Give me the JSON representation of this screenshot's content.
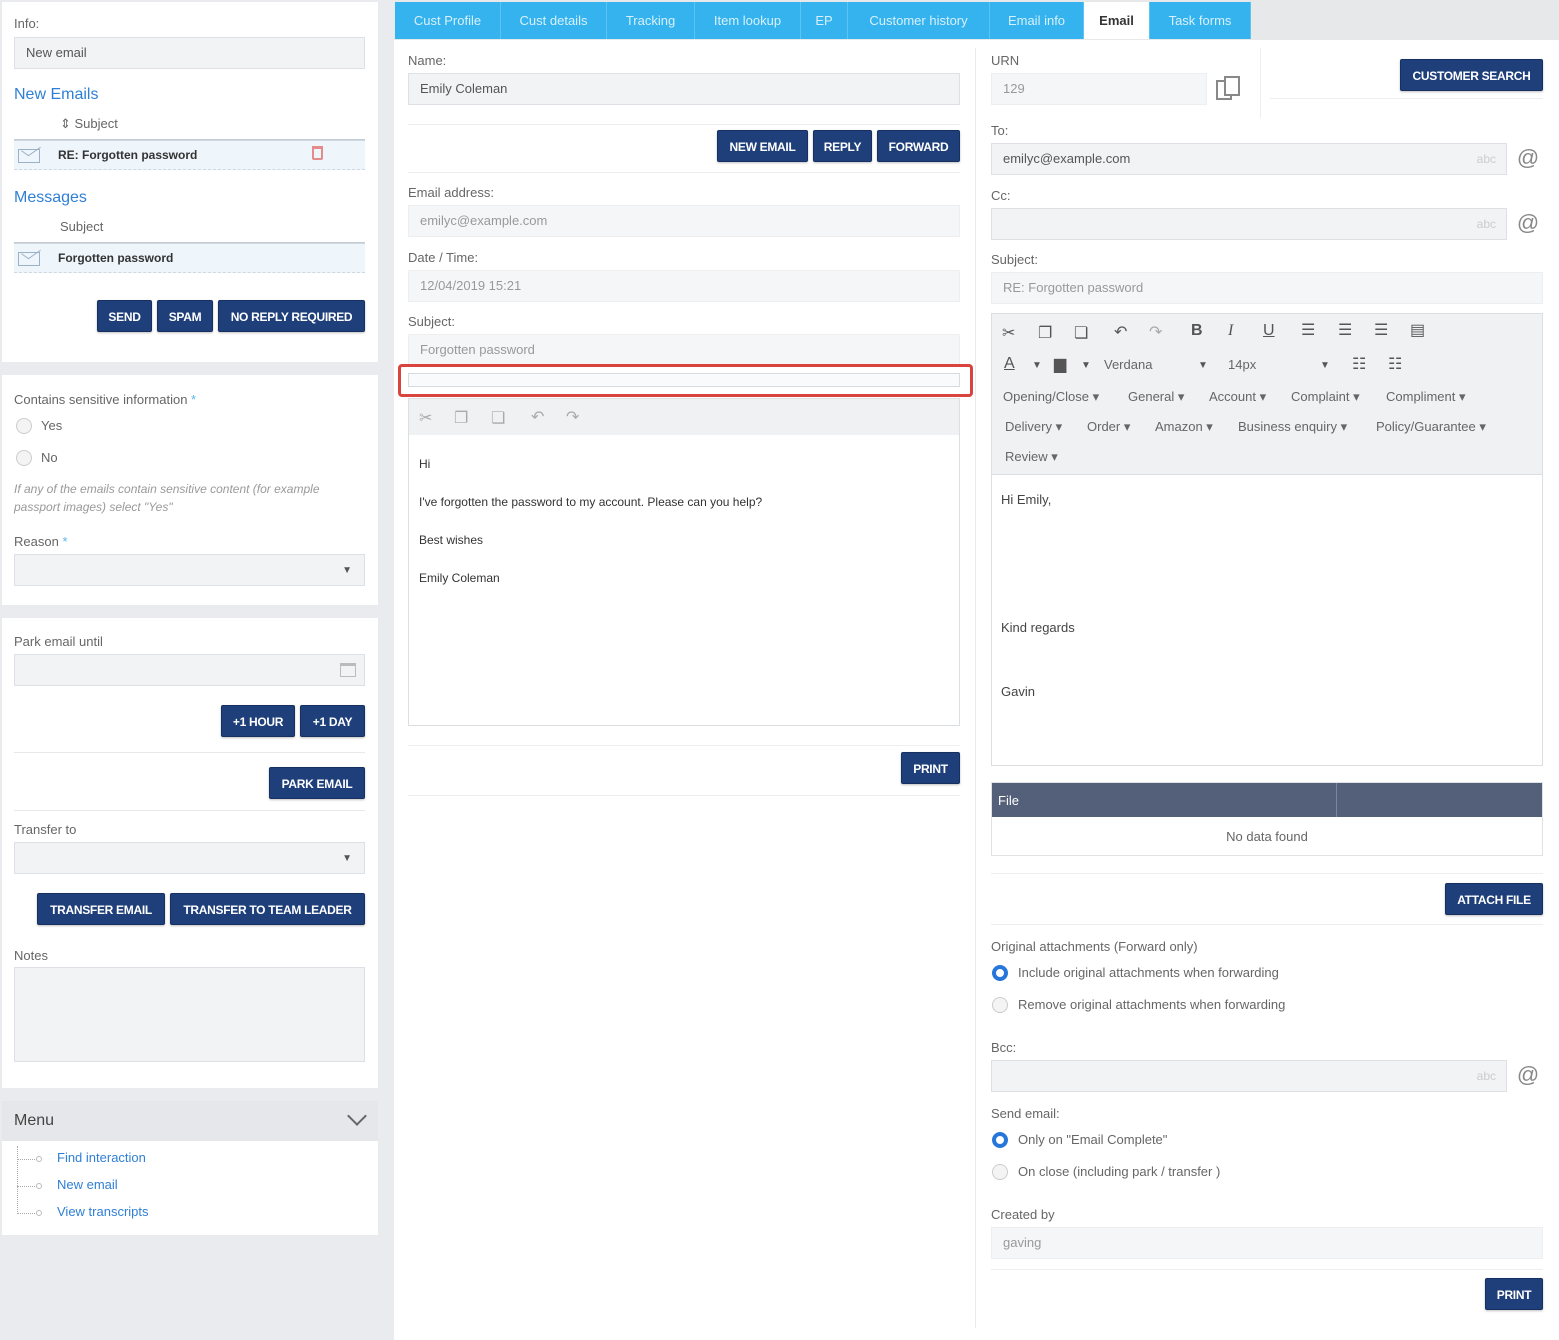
{
  "left": {
    "info_label": "Info:",
    "info_value": "New email",
    "new_emails_title": "New Emails",
    "new_emails_subject_header": "⇕ Subject",
    "new_emails": [
      {
        "subject": "RE: Forgotten password"
      }
    ],
    "messages_title": "Messages",
    "messages_subject_header": "Subject",
    "messages": [
      {
        "subject": "Forgotten password"
      }
    ],
    "send_label": "SEND",
    "spam_label": "SPAM",
    "no_reply_label": "NO REPLY REQUIRED",
    "sensitive_label": "Contains sensitive information",
    "required_mark": "*",
    "yes_label": "Yes",
    "no_label": "No",
    "sensitive_help": "If any of the emails contain sensitive content (for example passport images) select \"Yes\"",
    "reason_label": "Reason",
    "park_label": "Park email until",
    "plus_hour_label": "+1 HOUR",
    "plus_day_label": "+1 DAY",
    "park_email_label": "PARK EMAIL",
    "transfer_label": "Transfer to",
    "transfer_email_label": "TRANSFER EMAIL",
    "transfer_team_label": "TRANSFER TO TEAM LEADER",
    "notes_label": "Notes",
    "menu_title": "Menu",
    "menu_items": [
      "Find interaction",
      "New email",
      "View transcripts"
    ]
  },
  "tabs": [
    "Cust Profile",
    "Cust details",
    "Tracking",
    "Item lookup",
    "EP",
    "Customer history",
    "Email info",
    "Email",
    "Task forms"
  ],
  "active_tab": "Email",
  "middle": {
    "name_label": "Name:",
    "name_value": "Emily Coleman",
    "new_email_label": "NEW EMAIL",
    "reply_label": "REPLY",
    "forward_label": "FORWARD",
    "email_label": "Email address:",
    "email_value": "emilyc@example.com",
    "datetime_label": "Date / Time:",
    "datetime_value": "12/04/2019 15:21",
    "subject_label": "Subject:",
    "subject_value": "Forgotten password",
    "body_lines": [
      "Hi",
      "I've forgotten the password to my account. Please can you help?",
      "Best wishes",
      "Emily Coleman"
    ],
    "print_label": "PRINT"
  },
  "right": {
    "urn_label": "URN",
    "urn_value": "129",
    "customer_search_label": "CUSTOMER SEARCH",
    "to_label": "To:",
    "to_value": "emilyc@example.com",
    "abc": "abc",
    "cc_label": "Cc:",
    "subject_label": "Subject:",
    "subject_value": "RE: Forgotten password",
    "font_name": "Verdana",
    "font_size": "14px",
    "templates_row1": [
      "Opening/Close ▾",
      "General ▾",
      "Account ▾",
      "Complaint ▾",
      "Compliment ▾"
    ],
    "templates_row2": [
      "Delivery ▾",
      "Order ▾",
      "Amazon ▾",
      "Business enquiry ▾",
      "Policy/Guarantee ▾"
    ],
    "templates_row3": [
      "Review ▾"
    ],
    "body_greeting": "Hi Emily,",
    "body_regards": "Kind regards",
    "body_signature": "Gavin",
    "file_header": "File",
    "no_data": "No data found",
    "attach_label": "ATTACH FILE",
    "orig_attach_label": "Original attachments (Forward only)",
    "include_label": "Include original attachments when forwarding",
    "remove_label": "Remove original attachments when forwarding",
    "bcc_label": "Bcc:",
    "send_email_label": "Send email:",
    "only_on_label": "Only on \"Email Complete\"",
    "on_close_label": "On close (including park / transfer )",
    "created_by_label": "Created by",
    "created_by_value": "gaving",
    "print_label": "PRINT"
  },
  "colors": {
    "accent": "#1e3f7a",
    "tab": "#35b3ee",
    "link": "#2f7fd6",
    "highlight": "#d9443f"
  }
}
